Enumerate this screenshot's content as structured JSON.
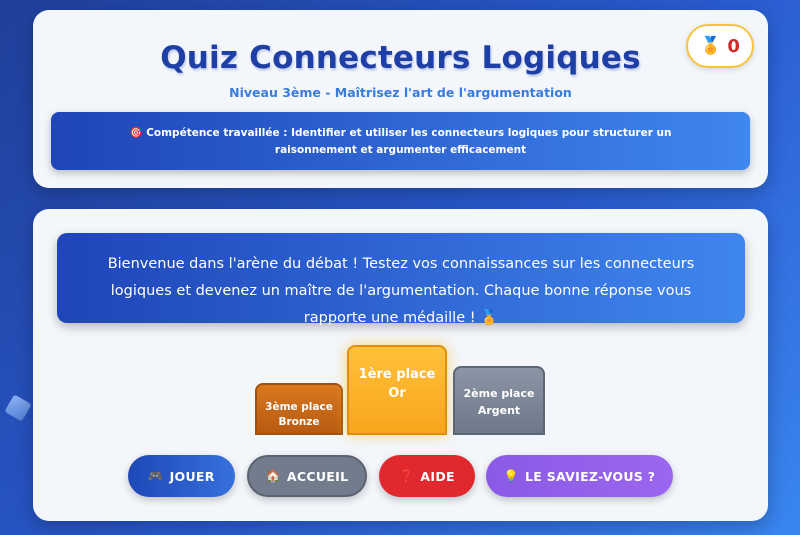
{
  "header": {
    "title": "Quiz Connecteurs Logiques",
    "subtitle": "Niveau 3ème - Maîtrisez l'art de l'argumentation",
    "score": {
      "medal": "🏅",
      "count": "0"
    },
    "competence": "🎯 Compétence travaillée : Identifier et utiliser les connecteurs logiques pour structurer un raisonnement et argumenter efficacement"
  },
  "main": {
    "welcome": "Bienvenue dans l'arène du débat ! Testez vos connaissances sur les connecteurs logiques et devenez un maître de l'argumentation. Chaque bonne réponse vous rapporte une médaille ! 🏅",
    "podium": {
      "bronze": {
        "place": "3ème place",
        "label": "Bronze"
      },
      "gold": {
        "place": "1ère place",
        "label": "Or"
      },
      "silver": {
        "place": "2ème place",
        "label": "Argent"
      }
    },
    "buttons": {
      "play": {
        "icon": "🎮",
        "label": "JOUER"
      },
      "home": {
        "icon": "🏠",
        "label": "ACCUEIL"
      },
      "help": {
        "icon": "❓",
        "label": "AIDE"
      },
      "know": {
        "icon": "💡",
        "label": "LE SAVIEZ-VOUS ?"
      }
    }
  },
  "colors": {
    "title": "#1e3fa6",
    "accent_blue": "#3f86ee",
    "gold": "#f7a51c",
    "bronze": "#b85a12",
    "silver": "#6f7888",
    "help_red": "#e0282e",
    "know_purple": "#9b66ee"
  }
}
